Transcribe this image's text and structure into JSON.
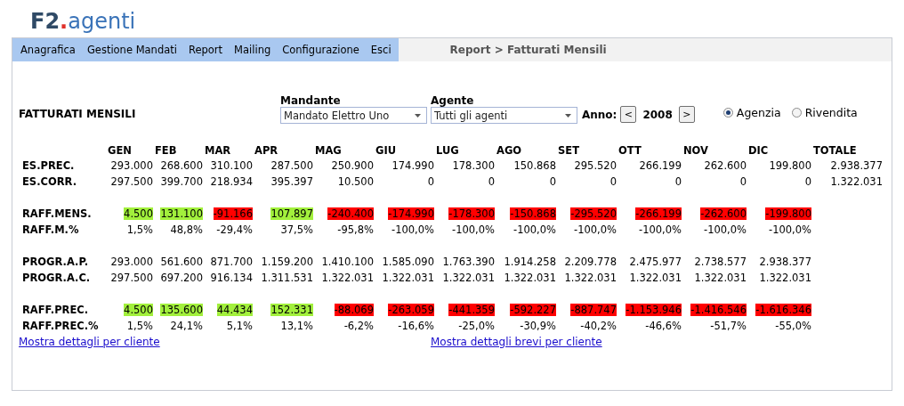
{
  "logo": {
    "parts": [
      {
        "text": "F2",
        "color": "#2f4a66"
      },
      {
        "text": ".",
        "color": "#e0302a"
      },
      {
        "text": "agenti",
        "color": "#3a73b8"
      }
    ]
  },
  "menu": [
    {
      "label": "Anagrafica"
    },
    {
      "label": "Gestione Mandati"
    },
    {
      "label": "Report"
    },
    {
      "label": "Mailing"
    },
    {
      "label": "Configurazione"
    },
    {
      "label": "Esci"
    }
  ],
  "breadcrumb": "Report > Fatturati Mensili",
  "page_title": "FATTURATI MENSILI",
  "filters": {
    "mandante": {
      "label": "Mandante",
      "value": "Mandato Elettro Uno"
    },
    "agente": {
      "label": "Agente",
      "value": "Tutti gli agenti"
    },
    "anno": {
      "label": "Anno:",
      "prev": "<",
      "value": "2008",
      "next": ">"
    },
    "radios": [
      {
        "label": "Agenzia",
        "selected": true
      },
      {
        "label": "Rivendita",
        "selected": false
      }
    ]
  },
  "table": {
    "columns": [
      "GEN",
      "FEB",
      "MAR",
      "APR",
      "MAG",
      "GIU",
      "LUG",
      "AGO",
      "SET",
      "OTT",
      "NOV",
      "DIC",
      "TOTALE"
    ],
    "groups": [
      {
        "rows": [
          {
            "label": "ES.PREC.",
            "kind": "plain",
            "values": [
              "293.000",
              "268.600",
              "310.100",
              "287.500",
              "250.900",
              "174.990",
              "178.300",
              "150.868",
              "295.520",
              "266.199",
              "262.600",
              "199.800",
              "2.938.377"
            ]
          },
          {
            "label": "ES.CORR.",
            "kind": "plain",
            "values": [
              "297.500",
              "399.700",
              "218.934",
              "395.397",
              "10.500",
              "0",
              "0",
              "0",
              "0",
              "0",
              "0",
              "0",
              "1.322.031"
            ]
          }
        ]
      },
      {
        "rows": [
          {
            "label": "RAFF.MENS.",
            "kind": "highlight",
            "cells": [
              {
                "value": "4.500",
                "color": "#a2f03c"
              },
              {
                "value": "131.100",
                "color": "#a2f03c"
              },
              {
                "value": "-91.166",
                "color": "#ff0000"
              },
              {
                "value": "107.897",
                "color": "#a2f03c"
              },
              {
                "value": "-240.400",
                "color": "#ff0000"
              },
              {
                "value": "-174.990",
                "color": "#ff0000"
              },
              {
                "value": "-178.300",
                "color": "#ff0000"
              },
              {
                "value": "-150.868",
                "color": "#ff0000"
              },
              {
                "value": "-295.520",
                "color": "#ff0000"
              },
              {
                "value": "-266.199",
                "color": "#ff0000"
              },
              {
                "value": "-262.600",
                "color": "#ff0000"
              },
              {
                "value": "-199.800",
                "color": "#ff0000"
              }
            ]
          },
          {
            "label": "RAFF.M.%",
            "kind": "plain",
            "values": [
              "1,5%",
              "48,8%",
              "-29,4%",
              "37,5%",
              "-95,8%",
              "-100,0%",
              "-100,0%",
              "-100,0%",
              "-100,0%",
              "-100,0%",
              "-100,0%",
              "-100,0%"
            ]
          }
        ]
      },
      {
        "rows": [
          {
            "label": "PROGR.A.P.",
            "kind": "plain",
            "values": [
              "293.000",
              "561.600",
              "871.700",
              "1.159.200",
              "1.410.100",
              "1.585.090",
              "1.763.390",
              "1.914.258",
              "2.209.778",
              "2.475.977",
              "2.738.577",
              "2.938.377"
            ]
          },
          {
            "label": "PROGR.A.C.",
            "kind": "plain",
            "values": [
              "297.500",
              "697.200",
              "916.134",
              "1.311.531",
              "1.322.031",
              "1.322.031",
              "1.322.031",
              "1.322.031",
              "1.322.031",
              "1.322.031",
              "1.322.031",
              "1.322.031"
            ]
          }
        ]
      },
      {
        "rows": [
          {
            "label": "RAFF.PREC.",
            "kind": "highlight",
            "cells": [
              {
                "value": "4.500",
                "color": "#a2f03c"
              },
              {
                "value": "135.600",
                "color": "#a2f03c"
              },
              {
                "value": "44.434",
                "color": "#a2f03c"
              },
              {
                "value": "152.331",
                "color": "#a2f03c"
              },
              {
                "value": "-88.069",
                "color": "#ff0000"
              },
              {
                "value": "-263.059",
                "color": "#ff0000"
              },
              {
                "value": "-441.359",
                "color": "#ff0000"
              },
              {
                "value": "-592.227",
                "color": "#ff0000"
              },
              {
                "value": "-887.747",
                "color": "#ff0000"
              },
              {
                "value": "-1.153.946",
                "color": "#ff0000"
              },
              {
                "value": "-1.416.546",
                "color": "#ff0000"
              },
              {
                "value": "-1.616.346",
                "color": "#ff0000"
              }
            ]
          },
          {
            "label": "RAFF.PREC.%",
            "kind": "plain",
            "values": [
              "1,5%",
              "24,1%",
              "5,1%",
              "13,1%",
              "-6,2%",
              "-16,6%",
              "-25,0%",
              "-30,9%",
              "-40,2%",
              "-46,6%",
              "-51,7%",
              "-55,0%"
            ]
          }
        ]
      }
    ]
  },
  "links": [
    "Mostra dettagli per cliente",
    "Mostra dettagli brevi per cliente"
  ]
}
